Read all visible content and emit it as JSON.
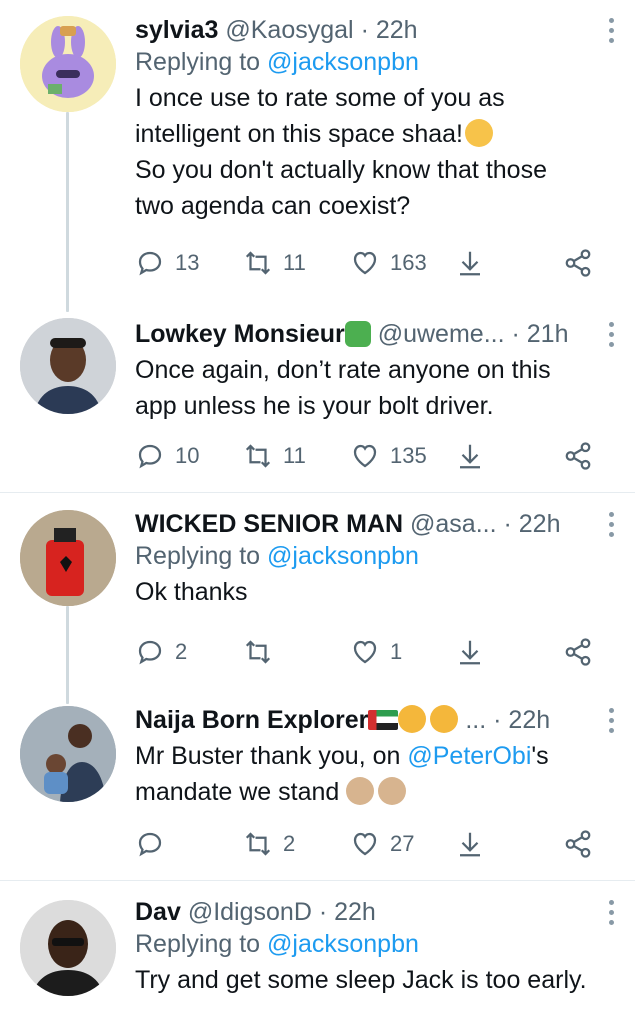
{
  "tweets": [
    {
      "name": "sylvia3",
      "handle": "@Kaosygal",
      "time": "· 22h",
      "replying_label": "Replying to",
      "replying_to": "@jacksonpbn",
      "text_lines": [
        "I once use to rate some of you as",
        "intelligent on this space shaa!",
        "So you don't actually know that those",
        "two agenda can coexist?"
      ],
      "replies": "13",
      "retweets": "11",
      "likes": "163"
    },
    {
      "name": "Lowkey Monsieur",
      "handle": "@uweme...",
      "time": "· 21h",
      "text_lines": [
        "Once again, don’t rate anyone on this",
        "app unless he is your bolt driver."
      ],
      "replies": "10",
      "retweets": "11",
      "likes": "135"
    },
    {
      "name": "WICKED SENIOR MAN",
      "handle": "@asa...",
      "time": "· 22h",
      "replying_label": "Replying to",
      "replying_to": "@jacksonpbn",
      "text_lines": [
        "Ok thanks"
      ],
      "replies": "2",
      "retweets": "",
      "likes": "1"
    },
    {
      "name": "Naija Born Explorer",
      "handle": "...",
      "time": "· 22h",
      "text_pre": "Mr Buster thank you, on ",
      "text_mention": "@PeterObi",
      "text_post": "'s",
      "text_line2": "mandate we stand",
      "replies": "",
      "retweets": "2",
      "likes": "27"
    },
    {
      "name": "Dav",
      "handle": "@IdigsonD",
      "time": "· 22h",
      "replying_label": "Replying to",
      "replying_to": "@jacksonpbn",
      "text_lines": [
        "Try and get some sleep Jack is too early."
      ]
    }
  ],
  "icons": [
    "reply-icon",
    "retweet-icon",
    "like-icon",
    "download-icon",
    "share-icon",
    "more-icon"
  ],
  "colors": {
    "accent": "#1d9bf0",
    "muted": "#536471",
    "thread_line": "#cfd9de"
  }
}
